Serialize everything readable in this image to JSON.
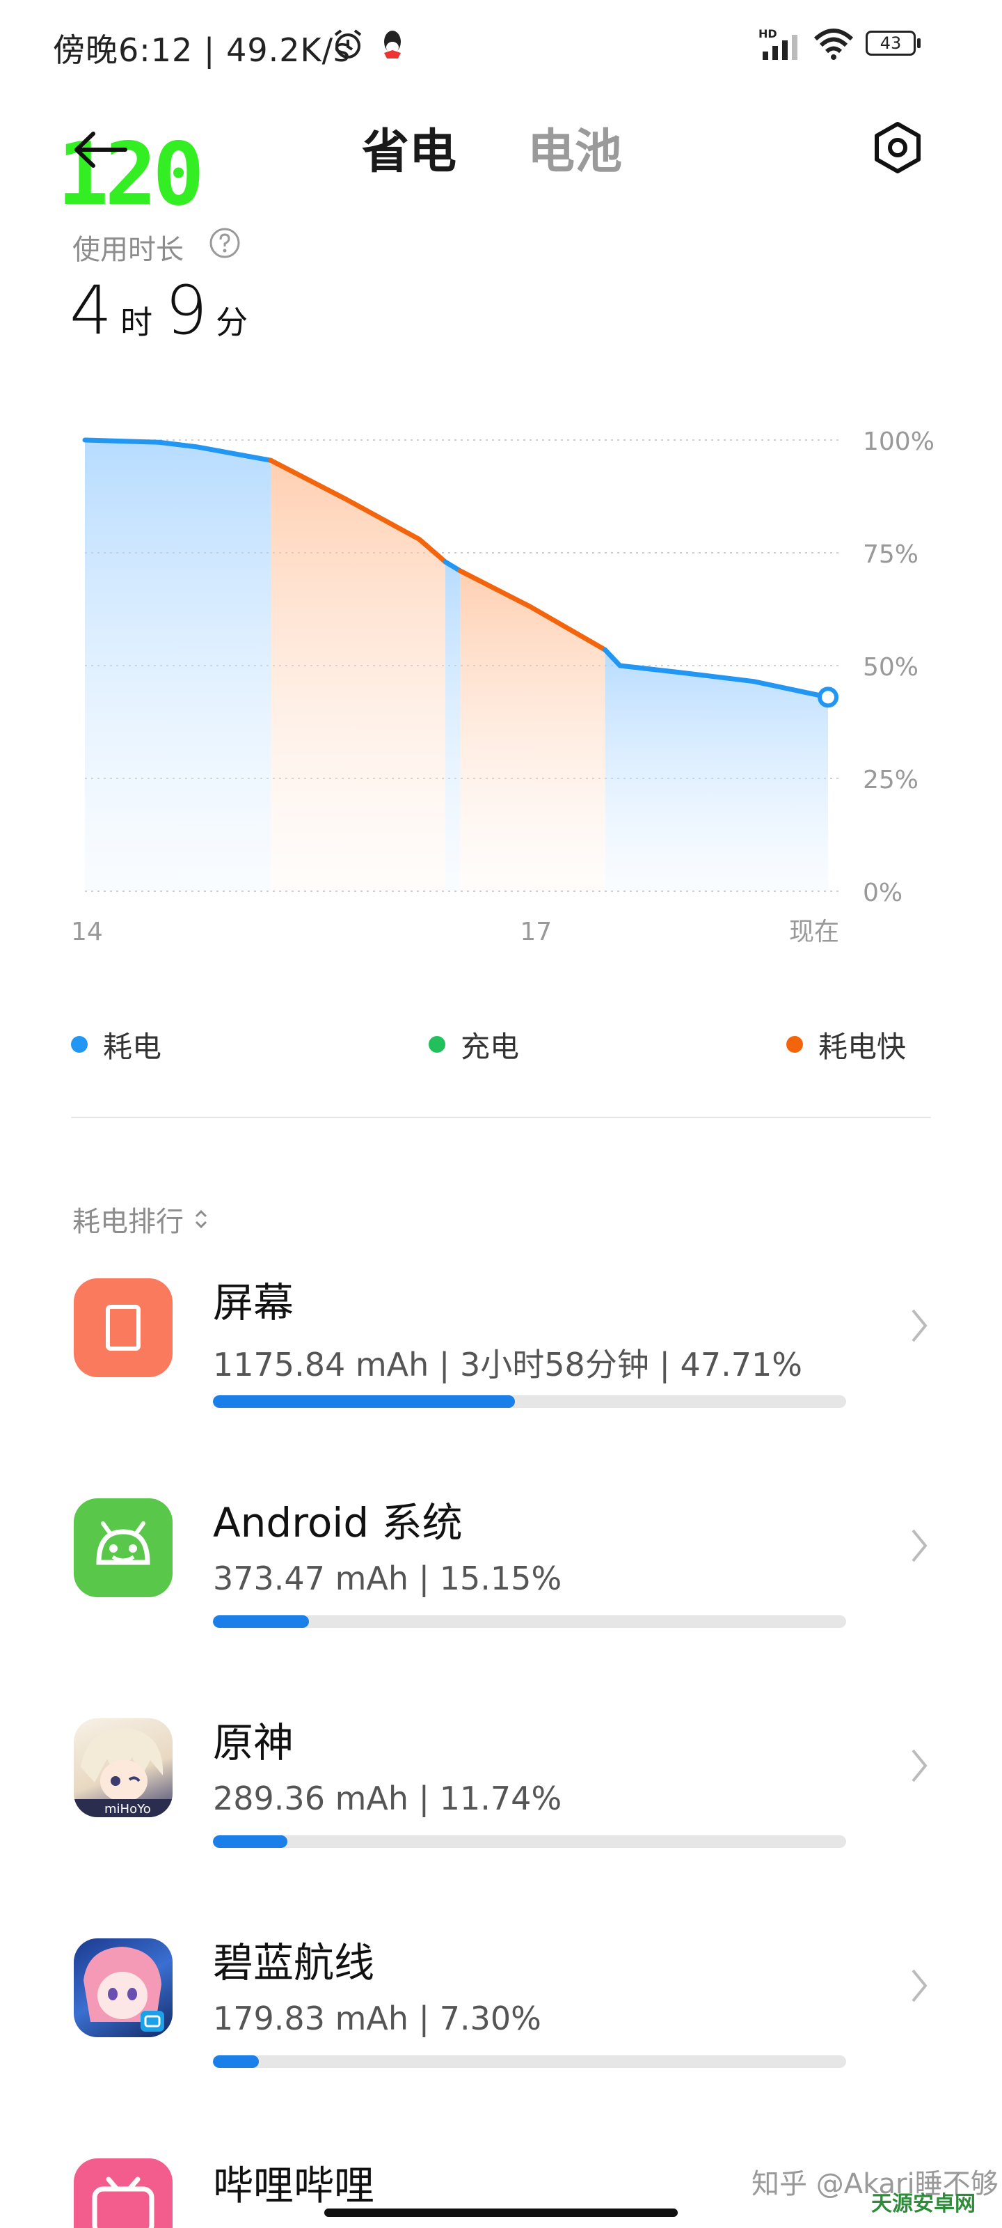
{
  "status_bar": {
    "time": "傍晚6:12",
    "network_speed": "49.2K/s",
    "battery": "43",
    "icons": [
      "alarm-icon",
      "qq-icon",
      "hd-signal-icon",
      "wifi-icon",
      "battery-icon"
    ]
  },
  "overlay": {
    "fps": "120"
  },
  "header": {
    "tabs": [
      {
        "label": "省电",
        "active": true
      },
      {
        "label": "电池",
        "active": false
      }
    ],
    "icons": [
      "back-arrow-icon",
      "settings-icon"
    ]
  },
  "usage": {
    "label": "使用时长",
    "hours": "4",
    "hours_unit": "时",
    "minutes": "9",
    "minutes_unit": "分"
  },
  "chart_data": {
    "type": "area",
    "x_ticks": [
      "14",
      "17",
      "现在"
    ],
    "y_ticks": [
      "100%",
      "75%",
      "50%",
      "25%",
      "0%"
    ],
    "ylim": [
      0,
      100
    ],
    "grid": true,
    "series": [
      {
        "name": "耗电",
        "x": [
          0,
          0.1,
          0.15,
          0.25
        ],
        "y": [
          100,
          99.5,
          98.5,
          95.5
        ]
      },
      {
        "name": "耗电快",
        "x": [
          0.25,
          0.35,
          0.45,
          0.485
        ],
        "y": [
          95.5,
          87,
          78,
          73
        ]
      },
      {
        "name": "耗电",
        "x": [
          0.485,
          0.505
        ],
        "y": [
          73,
          71
        ]
      },
      {
        "name": "耗电快",
        "x": [
          0.505,
          0.6,
          0.7
        ],
        "y": [
          71,
          63,
          53.5
        ]
      },
      {
        "name": "耗电",
        "x": [
          0.7,
          0.72,
          0.8,
          0.9,
          1.0
        ],
        "y": [
          53.5,
          50,
          48.5,
          46.5,
          43
        ]
      }
    ],
    "fast_drain_ranges": [
      [
        0.25,
        0.485
      ],
      [
        0.505,
        0.7
      ]
    ],
    "colors": {
      "drain": "#2196f3",
      "charge": "#22c05a",
      "fast_drain": "#f2650d"
    }
  },
  "legend": [
    {
      "label": "耗电",
      "color": "#2196f3"
    },
    {
      "label": "充电",
      "color": "#22c05a"
    },
    {
      "label": "耗电快",
      "color": "#f2650d"
    }
  ],
  "ranking": {
    "sort_label": "耗电排行",
    "apps": [
      {
        "name": "屏幕",
        "detail": "1175.84 mAh | 3小时58分钟 | 47.71%",
        "share": 47.71,
        "icon": "screen-icon"
      },
      {
        "name": "Android 系统",
        "detail": "373.47 mAh | 15.15%",
        "share": 15.15,
        "icon": "android-icon"
      },
      {
        "name": "原神",
        "detail": "289.36 mAh | 11.74%",
        "share": 11.74,
        "icon": "genshin-app-icon"
      },
      {
        "name": "碧蓝航线",
        "detail": "179.83 mAh | 7.30%",
        "share": 7.3,
        "icon": "azur-lane-app-icon"
      },
      {
        "name": "哔哩哔哩",
        "detail": "",
        "share": 0,
        "icon": "bilibili-app-icon"
      }
    ]
  },
  "watermark": {
    "text": "知乎 @Akari睡不够",
    "logo_text": "天源安卓网"
  }
}
